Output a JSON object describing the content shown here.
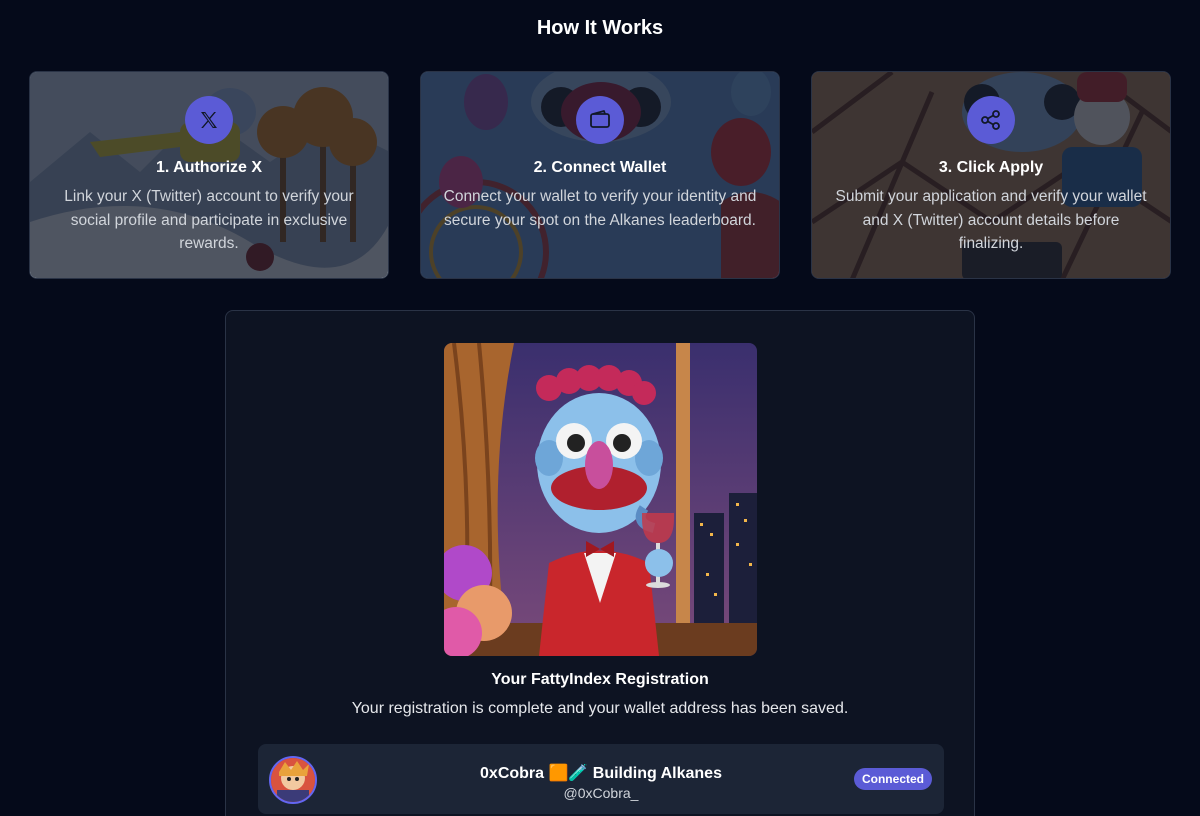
{
  "section_title": "How It Works",
  "steps": [
    {
      "title": "1. Authorize X",
      "description": "Link your X (Twitter) account to verify your social profile and participate in exclusive rewards.",
      "icon": "x-logo-icon"
    },
    {
      "title": "2. Connect Wallet",
      "description": "Connect your wallet to verify your identity and secure your spot on the Alkanes leaderboard.",
      "icon": "wallet-icon"
    },
    {
      "title": "3. Click Apply",
      "description": "Submit your application and verify your wallet and X (Twitter) account details before finalizing.",
      "icon": "share-icon"
    }
  ],
  "registration": {
    "title": "Your FattyIndex Registration",
    "description": "Your registration is complete and your wallet address has been saved."
  },
  "account": {
    "display_name": "0xCobra 🟧🧪 Building Alkanes",
    "handle": "@0xCobra_",
    "status": "Connected"
  },
  "colors": {
    "background": "#050a1a",
    "accent": "#5b5bd6",
    "card_border": "#2a3346",
    "row_background": "#1c2536"
  }
}
